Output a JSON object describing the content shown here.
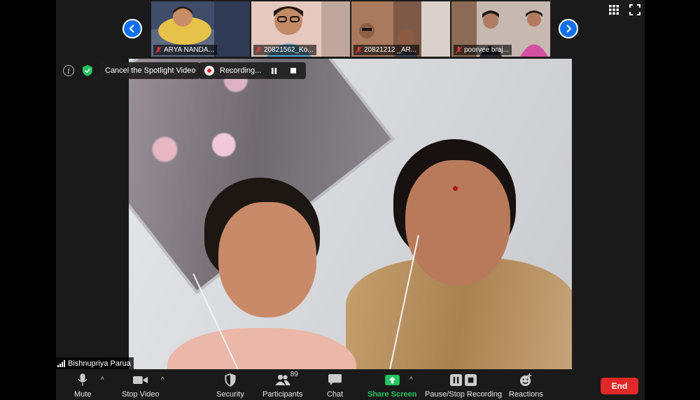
{
  "thumbnails": [
    {
      "name": "ARYA NANDA...",
      "muted": true,
      "bg": "#c9b98f"
    },
    {
      "name": "20821562_Ko...",
      "muted": true,
      "bg": "#d8c0b4"
    },
    {
      "name": "20821212 _AR...",
      "muted": true,
      "bg": "#8a6c5c"
    },
    {
      "name": "poorvee braj...",
      "muted": true,
      "bg": "#d7c9c5"
    }
  ],
  "overlay": {
    "spotlight_label": "Cancel the Spotlight Video",
    "recording_label": "Recording..."
  },
  "active_speaker": {
    "name": "Bishnupriya Parua"
  },
  "toolbar": {
    "mute": "Mute",
    "stop_video": "Stop Video",
    "security": "Security",
    "participants": "Participants",
    "participants_count": "89",
    "chat": "Chat",
    "share_screen": "Share Screen",
    "pause_stop_recording": "Pause/Stop Recording",
    "reactions": "Reactions",
    "end": "End"
  },
  "colors": {
    "accent_blue": "#0e71eb",
    "share_green": "#23c55e",
    "end_red": "#e02828",
    "secure_green": "#23c55e"
  }
}
